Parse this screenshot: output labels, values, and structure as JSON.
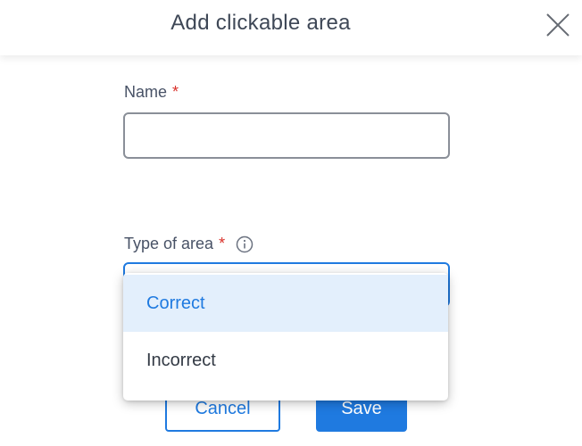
{
  "dialog": {
    "title": "Add clickable area"
  },
  "form": {
    "name": {
      "label": "Name",
      "required_marker": "*",
      "value": "",
      "placeholder": ""
    },
    "type_of_area": {
      "label": "Type of area",
      "required_marker": "*",
      "info_icon": "info-icon",
      "selected": "Correct",
      "options": [
        "Correct",
        "Incorrect"
      ]
    }
  },
  "buttons": {
    "cancel": "Cancel",
    "save": "Save"
  },
  "colors": {
    "accent": "#1f7ae0",
    "required": "#d9312a",
    "selected_option_bg": "#e3effc"
  }
}
